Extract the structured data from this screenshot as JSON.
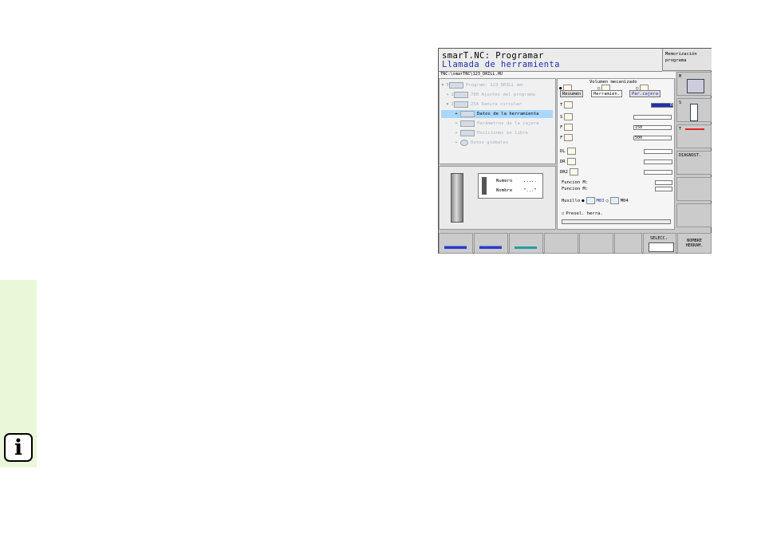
{
  "screen": {
    "title_line1": "smarT.NC: Programar",
    "title_line2": "Llamada de herramienta",
    "mode_label": "Memorización programa",
    "path": "TNC:\\smarTNC\\123_DRILL.HU"
  },
  "tree": {
    "items": [
      {
        "marker": "▼ 0",
        "label": "Program: 123_DRILL mm"
      },
      {
        "marker": "+ 1",
        "label": "700 Ajustes del programa"
      },
      {
        "marker": "▼ 2",
        "label": "254 Ranura circular"
      },
      {
        "marker": "+",
        "label": "Datos de la herramienta"
      },
      {
        "marker": "+",
        "label": "Parámetros de la cajera"
      },
      {
        "marker": "+",
        "label": "Posiciones en libre"
      },
      {
        "marker": "+",
        "label": "Datos globales"
      }
    ]
  },
  "preview": {
    "numero_label": "Numero",
    "numero_value": ".....",
    "nombre_label": "Nombre",
    "nombre_value": "\"...\""
  },
  "form": {
    "volume_label": "Volumen mecanizado",
    "tabs": [
      "Resumen",
      "Herramien.",
      "Par.cajera"
    ],
    "t_label": "T",
    "t_value": "0",
    "s_label": "S",
    "f_label": "F",
    "f_value": "150",
    "fz_label": "F",
    "fz_value": "500",
    "dl_label": "DL",
    "dr_label": "DR",
    "dr2_label": "DR2",
    "funcion1_label": "Funcion M:",
    "funcion2_label": "Funcion M:",
    "husillo_label": "Husillo",
    "m03_label": "M03",
    "m04_label": "M04",
    "presel_label": "Presel. herra."
  },
  "softkeys_right": {
    "diagnost_label": "DIAGNOST."
  },
  "softkeys_bottom": {
    "selecc_label": "SELECC.",
    "nombre_label": "NOMBRE HERRAM."
  },
  "colors": {
    "title_blue": "#1f2fb2",
    "selection_blue": "#a9d7ff",
    "sidebar_green": "#eaf7d8"
  }
}
